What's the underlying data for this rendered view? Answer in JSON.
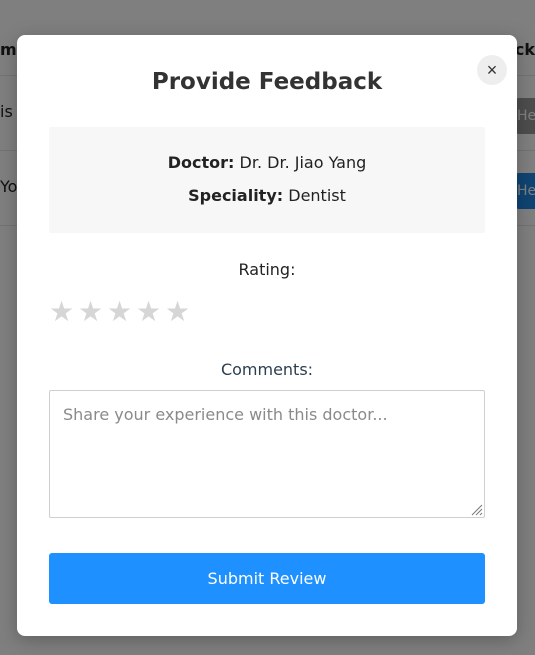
{
  "background": {
    "header_left": "me",
    "header_right": "ack",
    "rows": [
      {
        "text": "is",
        "button_label": "He"
      },
      {
        "text": "Yo",
        "button_label": "He"
      }
    ]
  },
  "modal": {
    "title": "Provide Feedback",
    "close_label": "×",
    "doctor_key": "Doctor:",
    "doctor_value": "Dr. Dr. Jiao Yang",
    "speciality_key": "Speciality:",
    "speciality_value": "Dentist",
    "rating_label": "Rating:",
    "stars": [
      "★",
      "★",
      "★",
      "★",
      "★"
    ],
    "rating_value": 0,
    "rating_max": 5,
    "comments_label": "Comments:",
    "comments_placeholder": "Share your experience with this doctor...",
    "comments_value": "",
    "submit_label": "Submit Review"
  },
  "colors": {
    "primary": "#1e90ff",
    "star_empty": "#d6d6d6",
    "info_bg": "#f7f7f7"
  }
}
